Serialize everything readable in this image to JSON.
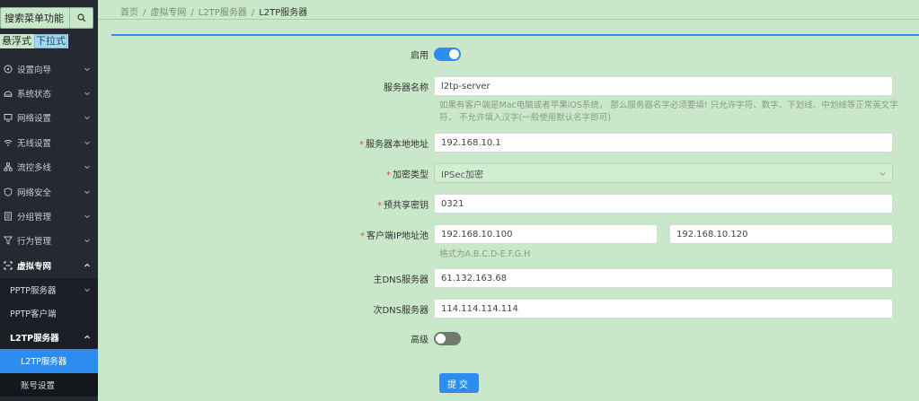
{
  "sidebar": {
    "search_label": "搜索菜单功能",
    "mode_floating": "悬浮式",
    "mode_dropdown": "下拉式",
    "items": [
      {
        "label": "设置向导"
      },
      {
        "label": "系统状态"
      },
      {
        "label": "网络设置"
      },
      {
        "label": "无线设置"
      },
      {
        "label": "流控多线"
      },
      {
        "label": "网络安全"
      },
      {
        "label": "分组管理"
      },
      {
        "label": "行为管理"
      },
      {
        "label": "虚拟专网"
      }
    ],
    "vpn_sub": {
      "pptp_server": "PPTP服务器",
      "pptp_client": "PPTP客户端",
      "l2tp_server": "L2TP服务器",
      "l2tp_children": {
        "l2tp_server": "L2TP服务器",
        "account_settings": "账号设置"
      }
    }
  },
  "breadcrumb": {
    "home": "首页",
    "vpn": "虚拟专网",
    "l2tp": "L2TP服务器",
    "current": "L2TP服务器",
    "sep": "/"
  },
  "form": {
    "enable_label": "启用",
    "enable_on": true,
    "server_name_label": "服务器名称",
    "server_name_value": "l2tp-server",
    "server_name_hint_1": "如果有客户端是Mac电脑或者苹果iOS系统， 那么服务器名字必须要填! 只允许字符、数字、下划线、中划线等正常英文字",
    "server_name_hint_2": "符， 不允许填入汉字(一般使用默认名字即可)",
    "local_addr_label": "服务器本地地址",
    "local_addr_value": "192.168.10.1",
    "encrypt_label": "加密类型",
    "encrypt_value": "IPSec加密",
    "psk_label": "预共享密钥",
    "psk_value": "0321",
    "pool_label": "客户端IP地址池",
    "pool_start": "192.168.10.100",
    "pool_end": "192.168.10.120",
    "pool_hint": "格式为A.B.C.D-E.F.G.H",
    "dns1_label": "主DNS服务器",
    "dns1_value": "61.132.163.68",
    "dns2_label": "次DNS服务器",
    "dns2_value": "114.114.114.114",
    "advanced_label": "高级",
    "advanced_on": false,
    "submit_label": "提交",
    "required_mark": "*"
  },
  "colors": {
    "accent": "#2d8cf0",
    "background": "#c9e8c9",
    "sidebar": "#252a32",
    "required": "#e74c3c"
  }
}
